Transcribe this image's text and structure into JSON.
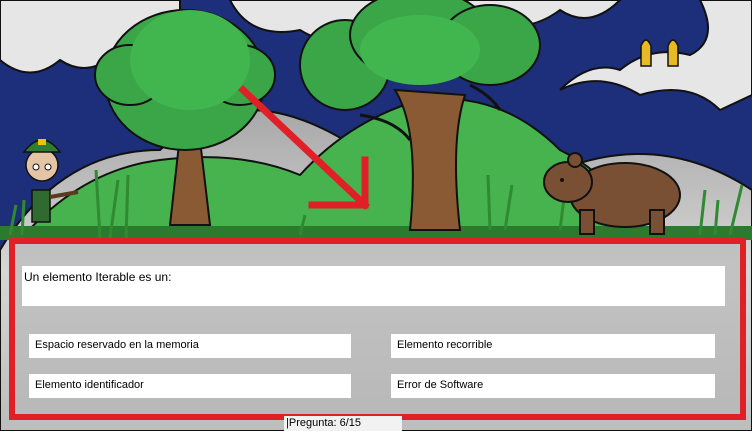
{
  "question": {
    "text": "Un elemento Iterable es un:"
  },
  "answers": [
    {
      "label": "Espacio reservado en la memoria"
    },
    {
      "label": "Elemento recorrible"
    },
    {
      "label": "Elemento identificador"
    },
    {
      "label": "Error de Software"
    }
  ],
  "status": {
    "question_counter": "|Pregunta: 6/15"
  },
  "hud": {
    "ammo_count": 2
  },
  "icons": {
    "player": "hunter-character-icon",
    "enemy": "bear-icon",
    "ammo": "bullet-icon",
    "hint": "arrow-icon"
  },
  "colors": {
    "highlight": "#e11f26",
    "tree_leaves": "#3aa648",
    "trunk": "#8a5a34",
    "bear": "#7a5035",
    "sky": "#1d2f7a"
  }
}
